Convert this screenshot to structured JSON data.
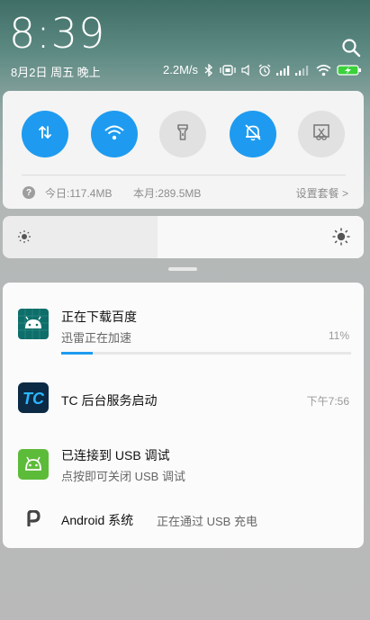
{
  "status": {
    "time": "8:39",
    "date": "8月2日 周五 晚上",
    "net_speed": "2.2M/s"
  },
  "icons": [
    "search-icon",
    "bluetooth-icon",
    "vibrate-icon",
    "alarm-icon",
    "signal-icon",
    "wifi-icon",
    "battery-icon"
  ],
  "quick_settings": {
    "toggles": [
      {
        "name": "mobile-data",
        "on": true
      },
      {
        "name": "wifi",
        "on": true
      },
      {
        "name": "flashlight",
        "on": false
      },
      {
        "name": "mute",
        "on": true
      },
      {
        "name": "screenshot",
        "on": false
      }
    ],
    "today_usage": "今日:117.4MB",
    "month_usage": "本月:289.5MB",
    "plan_link": "设置套餐 >"
  },
  "brightness": {
    "level": 0.43
  },
  "notifications": [
    {
      "title": "正在下载百度",
      "subtitle": "迅雷正在加速",
      "progress_text": "11%",
      "progress": 0.11
    },
    {
      "title": "TC  后台服务启动",
      "time": "下午7:56"
    },
    {
      "title": "已连接到  USB  调试",
      "subtitle": "点按即可关闭 USB 调试"
    },
    {
      "title": "Android  系统",
      "detail": "正在通过 USB 充电"
    }
  ],
  "colors": {
    "accent": "#1e9bf0",
    "toggle_off": "#e1e1e1",
    "tc_icon": "#0c2a44",
    "usb_icon": "#5dbb3a",
    "download_icon": "#0e6e6a"
  }
}
